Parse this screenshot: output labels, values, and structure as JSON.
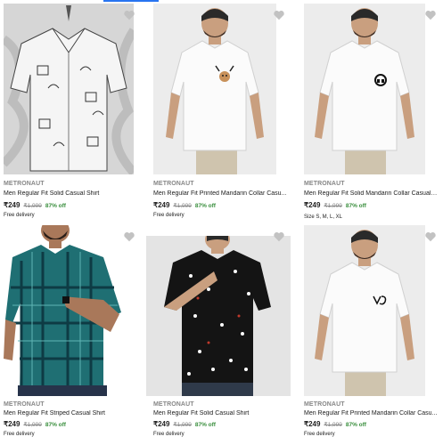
{
  "products": [
    {
      "brand": "METRONAUT",
      "title": "Men Regular Fit Solid Casual Shirt",
      "price": "₹249",
      "mrp": "₹1,999",
      "discount": "87% off",
      "delivery": "Free delivery"
    },
    {
      "brand": "METRONAUT",
      "title": "Men Regular Fit Printed Mandarin Collar Casu...",
      "price": "₹249",
      "mrp": "₹1,999",
      "discount": "87% off",
      "delivery": "Free delivery"
    },
    {
      "brand": "METRONAUT",
      "title": "Men Regular Fit Solid Mandarin Collar Casual ...",
      "price": "₹249",
      "mrp": "₹1,999",
      "discount": "87% off",
      "sizes": "Size S, M, L, XL"
    },
    {
      "brand": "METRONAUT",
      "title": "Men Regular Fit Striped Casual Shirt",
      "price": "₹249",
      "mrp": "₹1,999",
      "discount": "87% off",
      "delivery": "Free delivery"
    },
    {
      "brand": "METRONAUT",
      "title": "Men Regular Fit Solid Casual Shirt",
      "price": "₹249",
      "mrp": "₹1,999",
      "discount": "87% off",
      "delivery": "Free delivery"
    },
    {
      "brand": "METRONAUT",
      "title": "Men Regular Fit Printed Mandarin Collar Casu...",
      "price": "₹249",
      "mrp": "₹1,999",
      "discount": "87% off",
      "delivery": "Free delivery"
    }
  ],
  "colors": {
    "accent": "#2874f0",
    "discount": "#388e3c",
    "muted": "#878787",
    "wishlist": "#c2c2c2"
  },
  "icons": {
    "wishlist": "heart-icon"
  }
}
